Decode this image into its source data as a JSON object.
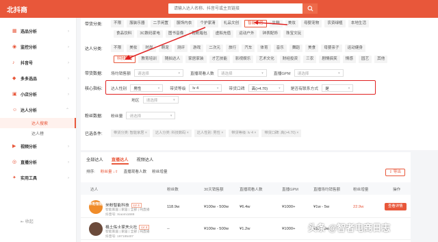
{
  "app": {
    "logo": "北抖商"
  },
  "search": {
    "placeholder": "请输入达人名称、抖音号或主页链接"
  },
  "sidebar": {
    "items": [
      {
        "label": "选品分析",
        "arrow": "›"
      },
      {
        "label": "监控分析",
        "arrow": "›"
      },
      {
        "label": "抖音号",
        "arrow": "›"
      },
      {
        "label": "多多选品",
        "arrow": "›"
      },
      {
        "label": "小店分析",
        "arrow": "›"
      },
      {
        "label": "达人分析",
        "arrow": "⌃"
      }
    ],
    "subs": [
      "达人搜索",
      "达人榜"
    ],
    "more": [
      {
        "label": "视频分析",
        "arrow": "›"
      },
      {
        "label": "直播分析",
        "arrow": "›"
      },
      {
        "label": "实用工具",
        "arrow": "›"
      }
    ],
    "collapse": "收起"
  },
  "filters": {
    "category_label": "带货分类:",
    "category_row1": [
      "不限",
      "服装乐器",
      "二手闲置",
      "服饰内衣",
      "个护家清",
      "礼品文创",
      "智能家居",
      "生鲜",
      "美妆",
      "母婴宠物",
      "农资绿植",
      "本地生活"
    ],
    "category_row2": [
      "食品饮料",
      "3C数码家电",
      "图书音像",
      "鞋靴箱包",
      "虚拟充值",
      "运动户外",
      "钟表配饰",
      "珠宝文玩"
    ],
    "talent_label": "达人分类:",
    "talent_row1": [
      "不限",
      "美妆",
      "时尚",
      "萌宠",
      "测评",
      "游戏",
      "二次元",
      "旅行",
      "汽车",
      "体育",
      "音乐",
      "舞蹈",
      "美食",
      "母婴亲子",
      "运动健身"
    ],
    "talent_row2": [
      "科技数码",
      "教育培训",
      "随拍达人",
      "家居家装",
      "才艺技能",
      "影视娱乐",
      "艺术文化",
      "财经投资",
      "三农",
      "剧情搞笑",
      "情感",
      "园艺",
      "其他"
    ],
    "sales_label": "带货数据:",
    "sales_fields": [
      {
        "label": "场均销售额",
        "placeholder": "请选择"
      },
      {
        "label": "直播观看人数",
        "placeholder": "请选择"
      },
      {
        "label": "直播GPM",
        "placeholder": "请选择"
      }
    ],
    "core_label": "核心指标:",
    "core_fields": [
      {
        "label": "达人性别",
        "value": "男性"
      },
      {
        "label": "带货等级",
        "value": "lv 4"
      },
      {
        "label": "带货口碑",
        "value": "高(>4.70)"
      },
      {
        "label": "是否有联系方式",
        "value": "是"
      }
    ],
    "region_label": "地区",
    "region_placeholder": "请选择",
    "fans_label": "粉丝数据:",
    "fans_field": {
      "label": "粉丝量",
      "placeholder": "请选择"
    },
    "selected_label": "已选条件:",
    "selected": [
      "带货分类: 智能家居",
      "达人分类: 科技数码",
      "达人性别: 男性",
      "带货等级: lv 4",
      "带货口碑: 高(>4.70)"
    ]
  },
  "results": {
    "tabs": [
      "全部达人",
      "直播达人",
      "视频达人"
    ],
    "sort_label": "排序:",
    "sorts": [
      "粉丝量 ↓⇧",
      "直播观看人数",
      "粉丝增量"
    ],
    "export": "导出",
    "headers": [
      "达人",
      "粉丝数",
      "30天销售额",
      "直播观看人数",
      "直播GPM",
      "直播场均销售额",
      "粉丝增量",
      "操作"
    ],
    "rows": [
      {
        "avatar": "米粉智能",
        "name": "米粉智能科技",
        "level": "LV 4",
        "meta": "智能家居 | 家居 | 全部 | 纯直播",
        "id": "抖音号: Xiaomi1688",
        "fans": "118.9w",
        "sales": "¥100w - 500w",
        "views": "¥6.4w",
        "gpm": "¥1000+",
        "avg": "¥1w - 5w",
        "growth": "22.9w",
        "action": "查看详情"
      },
      {
        "avatar": "",
        "name": "格土佑士家夫火社",
        "level": "LV 4",
        "meta": "智能家居 | 家居 | 全部 | 纯直播",
        "id": "抖音号: 197185407",
        "fans": "--",
        "sales": "¥100w - 500w",
        "views": "¥1.2w",
        "gpm": "¥1000+",
        "avg": "¥1w - 5w",
        "growth": "",
        "action": ""
      }
    ]
  },
  "watermark": "头条 @智者电商日志"
}
